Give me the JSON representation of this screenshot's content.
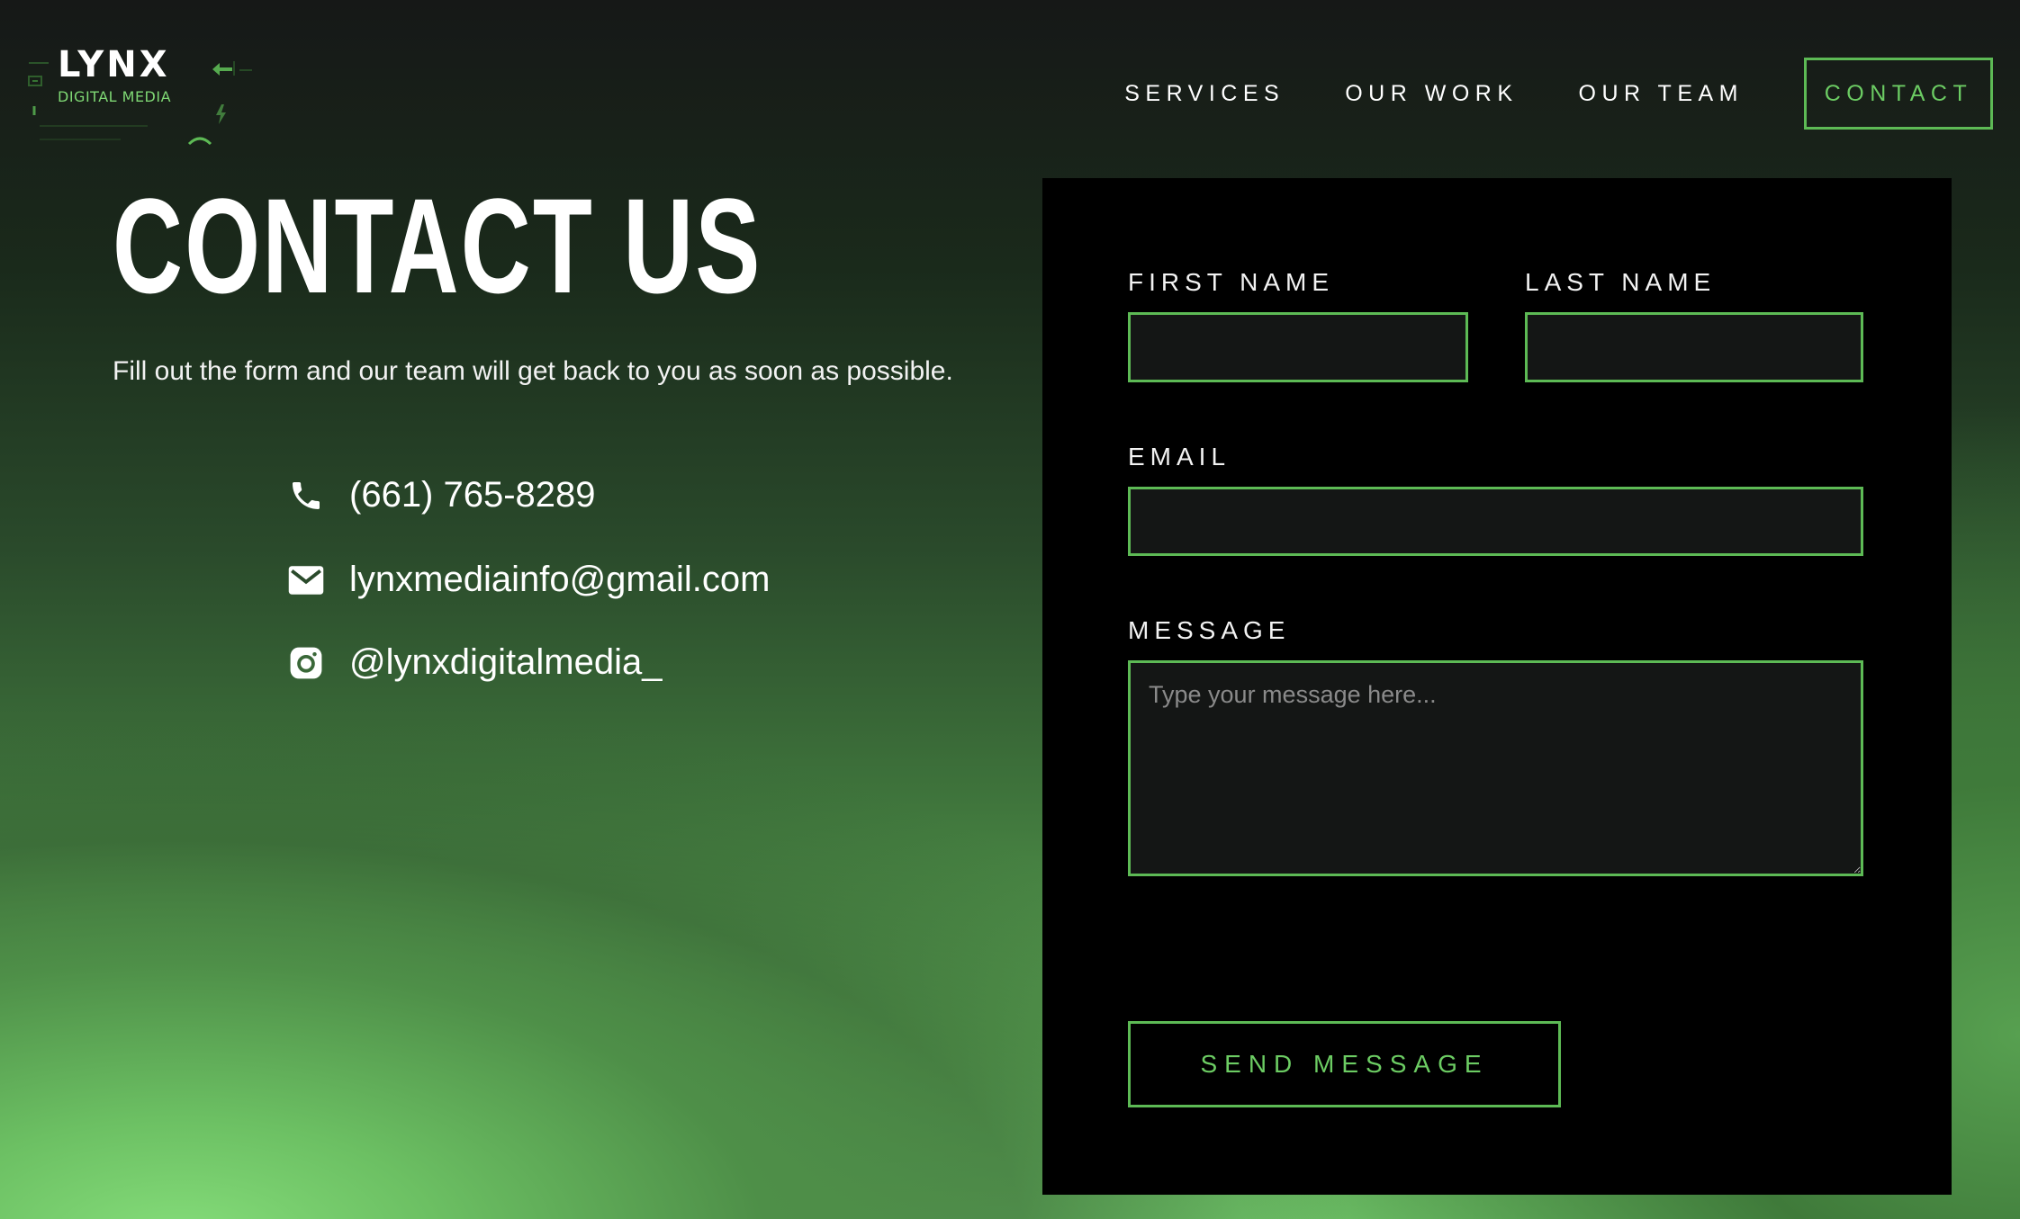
{
  "brand": {
    "name": "LYNX",
    "tagline": "DIGITAL MEDIA",
    "accent_color": "#5dba55"
  },
  "nav": {
    "items": [
      {
        "label": "SERVICES"
      },
      {
        "label": "OUR WORK"
      },
      {
        "label": "OUR TEAM"
      }
    ],
    "contact_label": "CONTACT"
  },
  "hero": {
    "title": "CONTACT US",
    "subtitle": "Fill out the form and our team will get back to you as soon as possible."
  },
  "contact_info": {
    "phone": {
      "icon": "phone-icon",
      "text": "(661) 765-8289"
    },
    "email": {
      "icon": "mail-icon",
      "text": "lynxmediainfo@gmail.com"
    },
    "instagram": {
      "icon": "instagram-icon",
      "text": "@lynxdigitalmedia_"
    }
  },
  "form": {
    "first_name": {
      "label": "FIRST NAME",
      "value": ""
    },
    "last_name": {
      "label": "LAST NAME",
      "value": ""
    },
    "email": {
      "label": "EMAIL",
      "value": ""
    },
    "message": {
      "label": "MESSAGE",
      "placeholder": "Type your message here...",
      "value": ""
    },
    "submit_label": "SEND MESSAGE"
  }
}
